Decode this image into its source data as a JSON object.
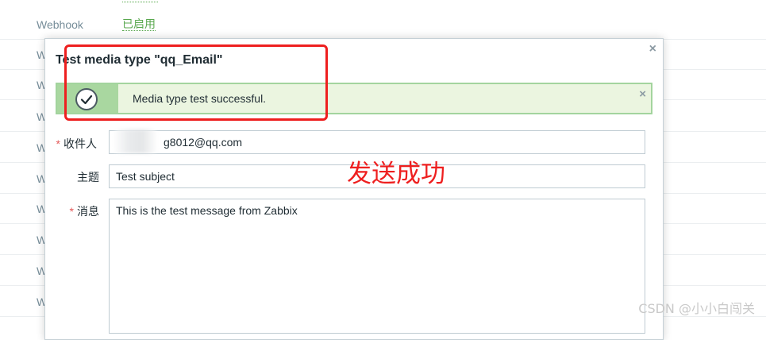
{
  "background_table": {
    "first_row": {
      "type": "Webhook",
      "status": "已启用"
    },
    "row_prefixes": [
      "W",
      "W",
      "W",
      "W",
      "W",
      "W",
      "W",
      "W",
      "W"
    ]
  },
  "dialog": {
    "title": "Test media type \"qq_Email\"",
    "close_glyph": "×",
    "message": {
      "text": "Media type test successful.",
      "close_glyph": "×",
      "icon": "check-circle-icon"
    },
    "fields": {
      "recipient_label": "收件人",
      "recipient_value": "g8012@qq.com",
      "subject_label": "主题",
      "subject_value": "Test subject",
      "message_label": "消息",
      "message_value": "This is the test message from Zabbix",
      "required_mark": "*"
    }
  },
  "annotation": {
    "text": "发送成功"
  },
  "watermark": "CSDN @小小白闯关",
  "colors": {
    "success_bg": "#ebf5e0",
    "success_border": "#a3d49e",
    "status_green": "#59a84e",
    "annotation_red": "#ee1f1f",
    "required_red": "#e45959"
  }
}
